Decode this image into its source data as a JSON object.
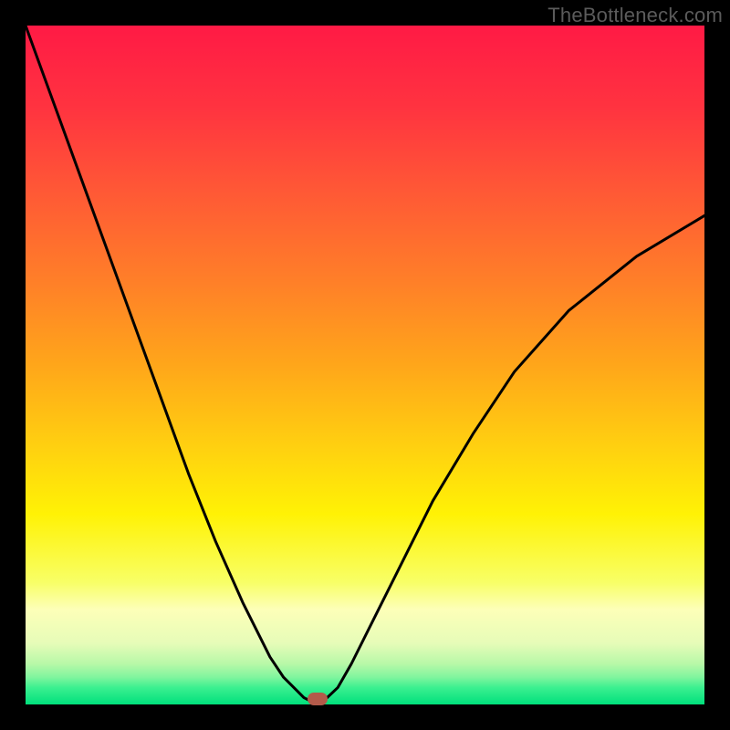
{
  "watermark": {
    "text": "TheBottleneck.com"
  },
  "chart_data": {
    "type": "line",
    "title": "",
    "xlabel": "",
    "ylabel": "",
    "xlim": [
      0,
      100
    ],
    "ylim": [
      0,
      100
    ],
    "grid": false,
    "legend": false,
    "background_gradient": {
      "stops": [
        {
          "pct": 0,
          "color": "#ff1a45"
        },
        {
          "pct": 12,
          "color": "#ff3340"
        },
        {
          "pct": 25,
          "color": "#ff5a35"
        },
        {
          "pct": 38,
          "color": "#ff8028"
        },
        {
          "pct": 50,
          "color": "#ffa61a"
        },
        {
          "pct": 62,
          "color": "#ffd010"
        },
        {
          "pct": 72,
          "color": "#fff205"
        },
        {
          "pct": 82,
          "color": "#f8ff66"
        },
        {
          "pct": 86,
          "color": "#fdffb8"
        },
        {
          "pct": 91,
          "color": "#e6fcb8"
        },
        {
          "pct": 94,
          "color": "#b8f8a8"
        },
        {
          "pct": 96,
          "color": "#80f59e"
        },
        {
          "pct": 97.5,
          "color": "#3cf090"
        },
        {
          "pct": 100,
          "color": "#00e07c"
        }
      ]
    },
    "curve": {
      "stroke": "#000000",
      "stroke_width": 3,
      "series": [
        {
          "x": [
            0,
            4,
            8,
            12,
            16,
            20,
            24,
            28,
            32,
            36,
            38,
            40,
            41,
            42,
            43
          ],
          "y": [
            100,
            89,
            78,
            67,
            56,
            45,
            34,
            24,
            15,
            7,
            4,
            2,
            1,
            0.5,
            0.2
          ]
        },
        {
          "x": [
            43,
            44,
            46,
            48,
            52,
            56,
            60,
            66,
            72,
            80,
            90,
            100
          ],
          "y": [
            0.2,
            0.6,
            2.5,
            6,
            14,
            22,
            30,
            40,
            49,
            58,
            66,
            72
          ]
        }
      ]
    },
    "marker": {
      "x": 43,
      "y": 0.8,
      "color": "#b35a4a"
    }
  }
}
